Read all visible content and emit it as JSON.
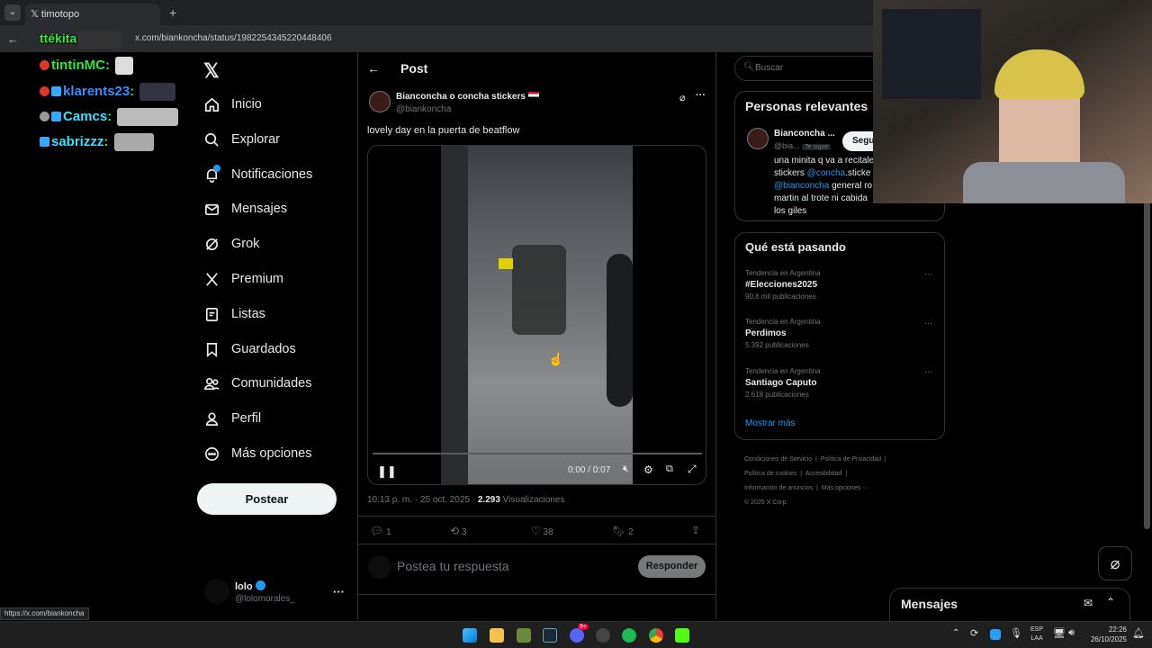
{
  "browser": {
    "tab_title": "timotopo",
    "url": "x.com/biankoncha/status/1982254345220448406",
    "status_url": "https://x.com/biankoncha"
  },
  "chat": {
    "line0": "ttékita",
    "line1_user": "tintinMC",
    "line2_user": "klarents23",
    "line3_user": "Camcs",
    "line4_user": "sabrizzz"
  },
  "nav": {
    "items": [
      {
        "label": "Inicio",
        "icon": "home-icon"
      },
      {
        "label": "Explorar",
        "icon": "search-icon"
      },
      {
        "label": "Notificaciones",
        "icon": "bell-icon"
      },
      {
        "label": "Mensajes",
        "icon": "mail-icon"
      },
      {
        "label": "Grok",
        "icon": "grok-icon"
      },
      {
        "label": "Premium",
        "icon": "x-logo-icon"
      },
      {
        "label": "Listas",
        "icon": "list-icon"
      },
      {
        "label": "Guardados",
        "icon": "bookmark-icon"
      },
      {
        "label": "Comunidades",
        "icon": "people-icon"
      },
      {
        "label": "Perfil",
        "icon": "person-icon"
      },
      {
        "label": "Más opciones",
        "icon": "more-circle-icon"
      }
    ],
    "post_button": "Postear",
    "user_name": "lolo",
    "user_handle": "@lolomorales_"
  },
  "post": {
    "header": "Post",
    "author_name": "Bianconcha o concha stickers",
    "author_handle": "@biankoncha",
    "text": "lovely day en la puerta de beatflow",
    "video_time": "0:00 / 0:07",
    "video_progress": 0.0,
    "timestamp": "10:13 p. m. · 25 oct. 2025 · ",
    "views_count": "2.293",
    "views_label": " Visualizaciones",
    "replies": "1",
    "reposts": "3",
    "likes": "38",
    "bookmarks": "2",
    "reply_placeholder": "Postea tu respuesta",
    "reply_button": "Responder"
  },
  "right": {
    "search_placeholder": "Buscar",
    "relevant_title": "Personas relevantes",
    "rel_name": "Bianconcha ...",
    "rel_handle": "@bia...",
    "rel_badge": "Te sigue",
    "rel_follow": "Segu",
    "rel_bio_1": "una minita q va a recitale",
    "rel_bio_2a": "stickers ",
    "rel_bio_2b": "@concha",
    "rel_bio_2c": ".sticke",
    "rel_bio_3a": "@bianconcha",
    "rel_bio_3b": " general ro",
    "rel_bio_4": "martin al trote ni cabida",
    "rel_bio_5": "los giles",
    "trends_title": "Qué está pasando",
    "trends": [
      {
        "context": "Tendencia en Argentina",
        "name": "#Elecciones2025",
        "count": "90,6 mil publicaciones"
      },
      {
        "context": "Tendencia en Argentina",
        "name": "Perdimos",
        "count": "5.392 publicaciones"
      },
      {
        "context": "Tendencia en Argentina",
        "name": "Santiago Caputo",
        "count": "2.618 publicaciones"
      }
    ],
    "show_more": "Mostrar más",
    "footer1": "Condiciones de Servicio",
    "footer2": "Política de Privacidad",
    "footer3": "Política de cookies",
    "footer4": "Accesibilidad",
    "footer5": "Información de anuncios",
    "footer6": "Más opciones ···",
    "footer7": "© 2025 X Corp.",
    "messages_title": "Mensajes"
  },
  "taskbar": {
    "lang1": "ESP",
    "lang2": "LAA",
    "time": "22:26",
    "date": "26/10/2025",
    "discord_badge": "9+"
  },
  "colors": {
    "accent": "#1d9bf0",
    "chat_green": "#2fe83f"
  }
}
